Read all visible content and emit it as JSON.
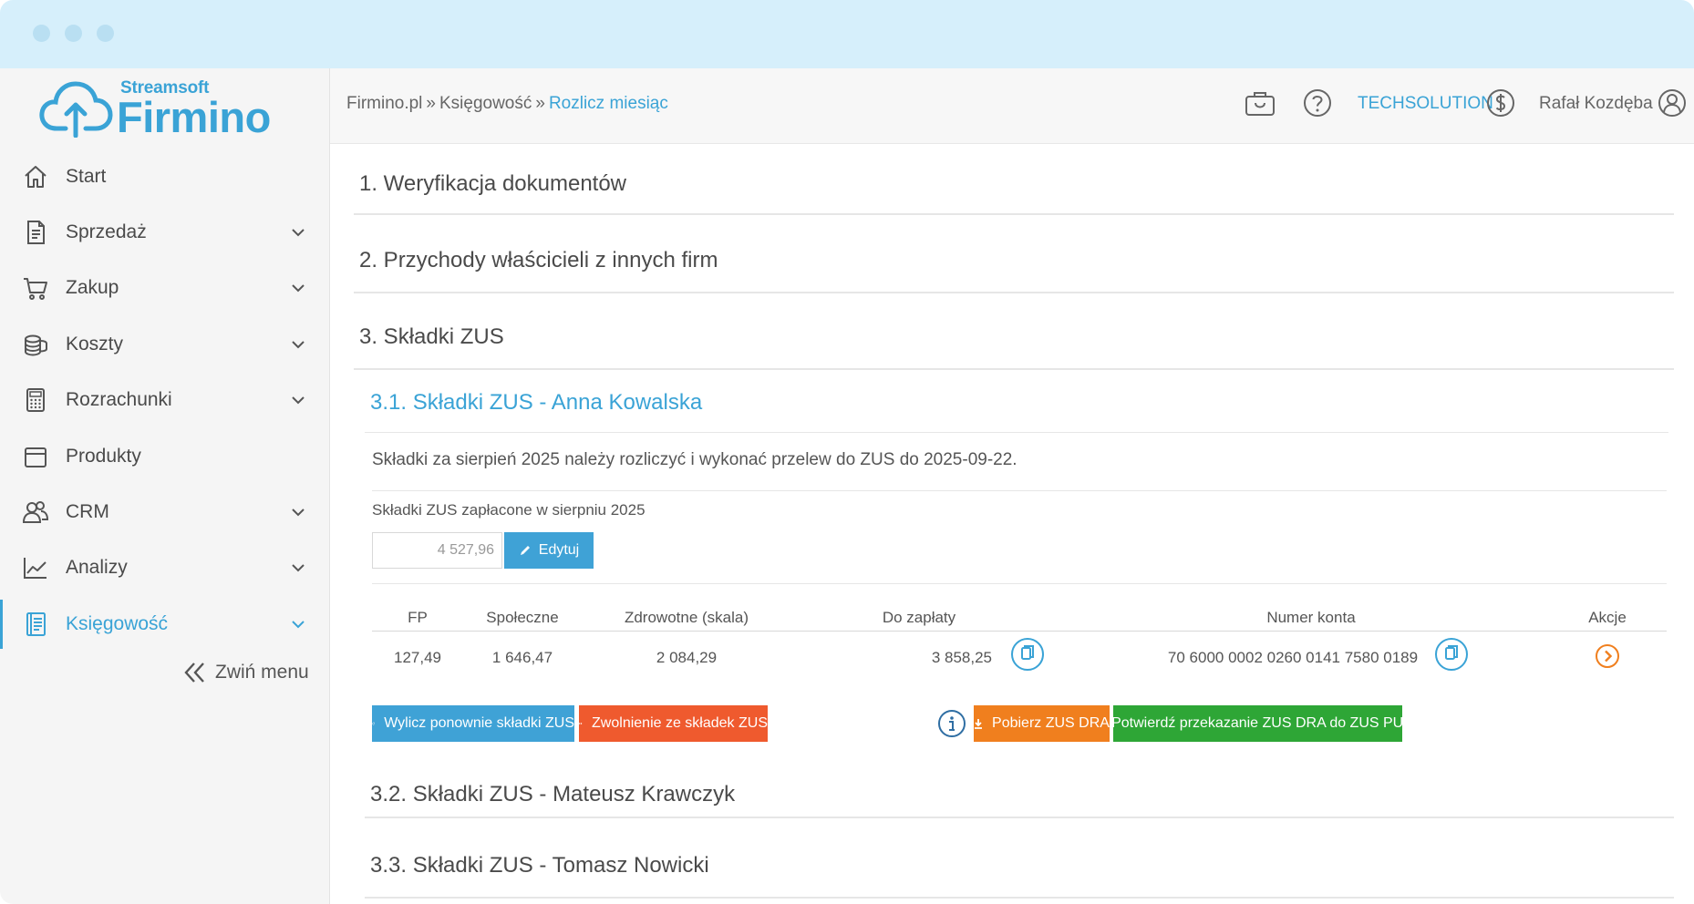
{
  "colors": {
    "accent": "#3aa3d6",
    "orange": "#f07f1e",
    "red_orange": "#ef5a2e",
    "green": "#2ea636",
    "blue_btn": "#3fa2d6"
  },
  "logo": {
    "sub": "Streamsoft",
    "main": "Firmino"
  },
  "sidebar": {
    "items": [
      {
        "label": "Start",
        "icon": "home-icon",
        "has_submenu": false
      },
      {
        "label": "Sprzedaż",
        "icon": "document-icon",
        "has_submenu": true
      },
      {
        "label": "Zakup",
        "icon": "cart-icon",
        "has_submenu": true
      },
      {
        "label": "Koszty",
        "icon": "coins-icon",
        "has_submenu": true
      },
      {
        "label": "Rozrachunki",
        "icon": "calculator-icon",
        "has_submenu": true
      },
      {
        "label": "Produkty",
        "icon": "box-icon",
        "has_submenu": false
      },
      {
        "label": "CRM",
        "icon": "users-icon",
        "has_submenu": true
      },
      {
        "label": "Analizy",
        "icon": "chart-icon",
        "has_submenu": true
      },
      {
        "label": "Księgowość",
        "icon": "ledger-icon",
        "has_submenu": true,
        "active": true
      }
    ],
    "collapse_label": "Zwiń menu"
  },
  "header": {
    "breadcrumb": [
      "Firmino.pl",
      "Księgowość",
      "Rozlicz miesiąc"
    ],
    "separator": "»",
    "company": "TECHSOLUTION",
    "user": "Rafał Kozdęba"
  },
  "sections": [
    {
      "title": "1. Weryfikacja dokumentów"
    },
    {
      "title": "2. Przychody właścicieli z innych firm"
    },
    {
      "title": "3. Składki ZUS"
    }
  ],
  "zus": {
    "sub1": {
      "title": "3.1. Składki ZUS - Anna Kowalska",
      "info": "Składki za sierpień 2025 należy rozliczyć i wykonać przelew do ZUS do 2025-09-22.",
      "paid_label": "Składki ZUS zapłacone w sierpniu 2025",
      "paid_value": "4 527,96",
      "edit_label": "Edytuj",
      "table": {
        "headers": [
          "FP",
          "Społeczne",
          "Zdrowotne (skala)",
          "Do zapłaty",
          "Numer konta",
          "Akcje"
        ],
        "row": {
          "fp": "127,49",
          "spoleczne": "1 646,47",
          "zdrowotne": "2 084,29",
          "do_zaplaty": "3 858,25",
          "numer_konta": "70 6000 0002 0260 0141 7580 0189"
        }
      },
      "buttons": {
        "recalc": "Wylicz ponownie składki ZUS",
        "exempt": "Zwolnienie ze składek ZUS",
        "download": "Pobierz ZUS DRA",
        "confirm": "Potwierdź przekazanie ZUS DRA do ZUS PUE"
      }
    },
    "sub2": {
      "title": "3.2. Składki ZUS - Mateusz Krawczyk"
    },
    "sub3": {
      "title": "3.3. Składki ZUS - Tomasz Nowicki"
    }
  }
}
